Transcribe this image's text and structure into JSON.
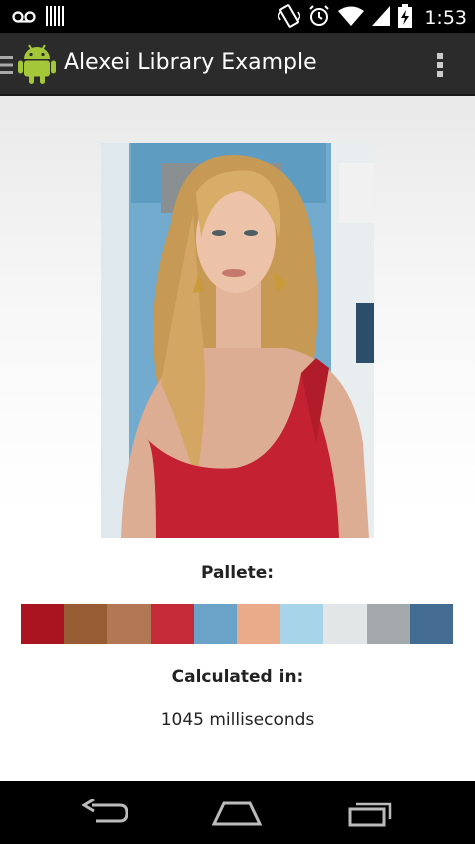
{
  "status_bar": {
    "time": "1:53",
    "icons": [
      "voicemail-icon",
      "barcode-icon",
      "vibrate-icon",
      "alarm-icon",
      "wifi-icon",
      "signal-icon",
      "battery-charging-icon"
    ]
  },
  "action_bar": {
    "title": "Alexei Library Example",
    "icons": [
      "drawer-icon",
      "android-app-icon",
      "overflow-menu-icon"
    ]
  },
  "main": {
    "photo_icon": "portrait-photo",
    "palette_heading": "Pallete:",
    "palette_colors": [
      "#aa1420",
      "#965c34",
      "#b27855",
      "#c52a38",
      "#6aa2c8",
      "#e9ab89",
      "#a8d4ea",
      "#e3e6e6",
      "#a4a9ac",
      "#446c92"
    ],
    "calculated_heading": "Calculated in:",
    "calculated_value": "1045 milliseconds"
  },
  "nav_bar": {
    "icons": [
      "back-icon",
      "home-icon",
      "recent-apps-icon"
    ]
  }
}
